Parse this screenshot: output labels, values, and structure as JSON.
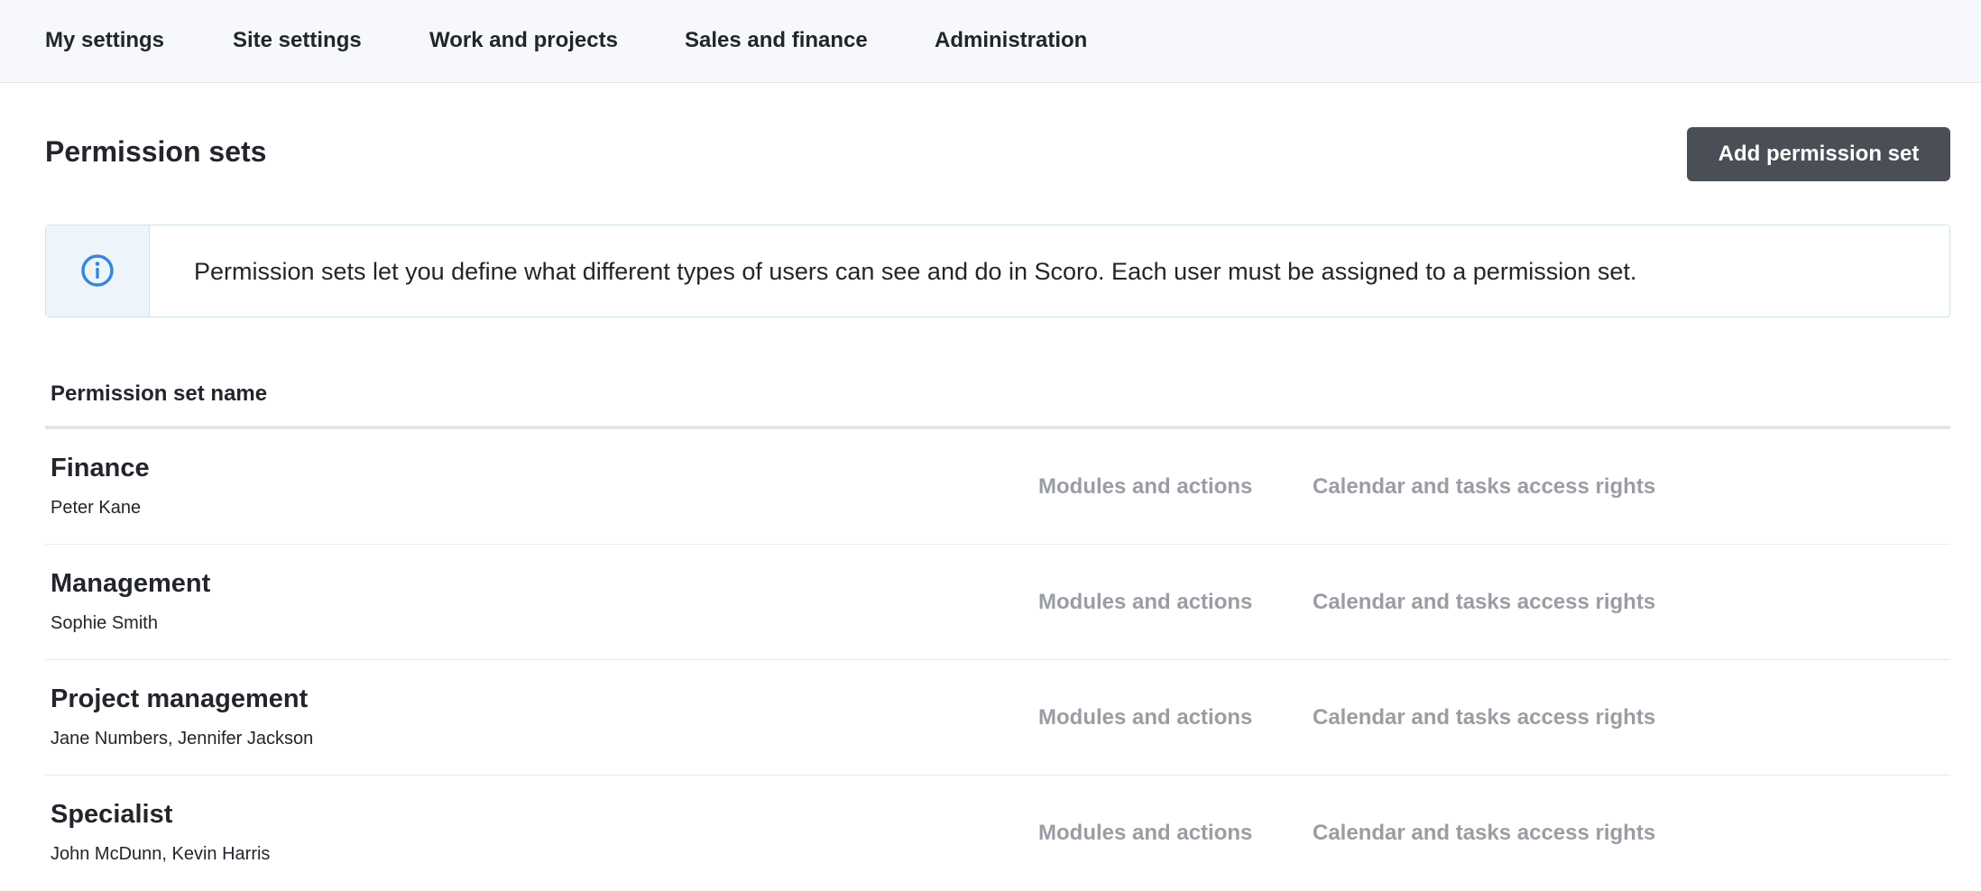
{
  "nav": {
    "items": [
      {
        "label": "My settings"
      },
      {
        "label": "Site settings"
      },
      {
        "label": "Work and projects"
      },
      {
        "label": "Sales and finance"
      },
      {
        "label": "Administration"
      }
    ]
  },
  "page": {
    "title": "Permission sets",
    "add_button_label": "Add permission set"
  },
  "info": {
    "icon": "info-circle-icon",
    "text": "Permission sets let you define what different types of users can see and do in Scoro. Each user must be assigned to a permission set.",
    "accent_color": "#3a86d6"
  },
  "table": {
    "column_header": "Permission set name",
    "rows": [
      {
        "name": "Finance",
        "users": "Peter Kane",
        "modules_link": "Modules and actions",
        "calendar_link": "Calendar and tasks access rights"
      },
      {
        "name": "Management",
        "users": "Sophie Smith",
        "modules_link": "Modules and actions",
        "calendar_link": "Calendar and tasks access rights"
      },
      {
        "name": "Project management",
        "users": "Jane Numbers, Jennifer Jackson",
        "modules_link": "Modules and actions",
        "calendar_link": "Calendar and tasks access rights"
      },
      {
        "name": "Specialist",
        "users": "John McDunn, Kevin Harris",
        "modules_link": "Modules and actions",
        "calendar_link": "Calendar and tasks access rights"
      }
    ]
  },
  "colors": {
    "button_bg": "#4a4e56",
    "link_muted": "#9a9da3",
    "nav_bg": "#f6f8fc"
  }
}
